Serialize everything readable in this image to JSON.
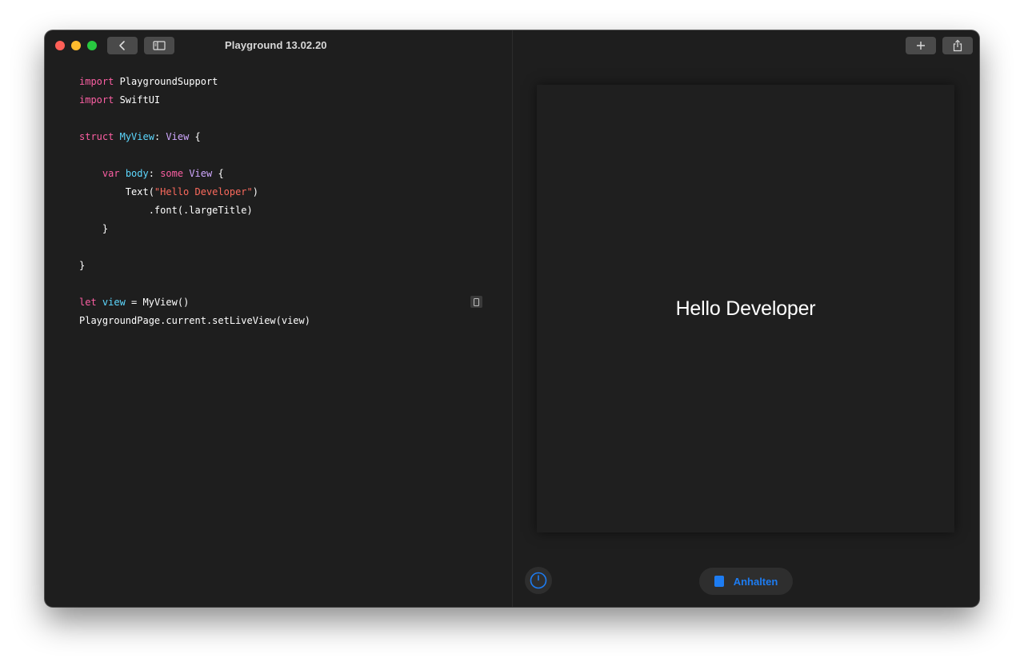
{
  "window": {
    "title": "Playground 13.02.20"
  },
  "toolbar": {
    "back_icon": "chevron-left-icon",
    "sidebar_icon": "sidebar-icon",
    "add_icon": "plus-icon",
    "share_icon": "share-icon"
  },
  "code": {
    "lines": [
      [
        {
          "t": "import",
          "c": "kw"
        },
        {
          "t": " PlaygroundSupport",
          "c": ""
        }
      ],
      [
        {
          "t": "import",
          "c": "kw"
        },
        {
          "t": " SwiftUI",
          "c": ""
        }
      ],
      [],
      [
        {
          "t": "struct",
          "c": "kw"
        },
        {
          "t": " ",
          "c": ""
        },
        {
          "t": "MyView",
          "c": "ty"
        },
        {
          "t": ": ",
          "c": ""
        },
        {
          "t": "View",
          "c": "sys"
        },
        {
          "t": " {",
          "c": ""
        }
      ],
      [],
      [
        {
          "t": "    ",
          "c": ""
        },
        {
          "t": "var",
          "c": "kw"
        },
        {
          "t": " ",
          "c": ""
        },
        {
          "t": "body",
          "c": "ty"
        },
        {
          "t": ": ",
          "c": ""
        },
        {
          "t": "some",
          "c": "kw"
        },
        {
          "t": " ",
          "c": ""
        },
        {
          "t": "View",
          "c": "sys"
        },
        {
          "t": " {",
          "c": ""
        }
      ],
      [
        {
          "t": "        Text(",
          "c": ""
        },
        {
          "t": "\"Hello Developer\"",
          "c": "str"
        },
        {
          "t": ")",
          "c": ""
        }
      ],
      [
        {
          "t": "            .font(.largeTitle)",
          "c": ""
        }
      ],
      [
        {
          "t": "    }",
          "c": ""
        }
      ],
      [],
      [
        {
          "t": "}",
          "c": ""
        }
      ],
      [],
      [
        {
          "t": "let",
          "c": "kw"
        },
        {
          "t": " ",
          "c": ""
        },
        {
          "t": "view",
          "c": "ty"
        },
        {
          "t": " = MyView()",
          "c": ""
        }
      ],
      [
        {
          "t": "PlaygroundPage.current.setLiveView(view)",
          "c": ""
        }
      ]
    ]
  },
  "live_view": {
    "text": "Hello Developer"
  },
  "footer": {
    "timer_icon": "timer-icon",
    "stop_icon": "stop-icon",
    "stop_label": "Anhalten"
  },
  "colors": {
    "window_bg": "#1e1e1e",
    "keyword": "#fc5fa3",
    "type": "#5dd8ff",
    "system_type": "#d0a8ff",
    "string": "#fc6a5d",
    "accent": "#1d7cf2"
  }
}
